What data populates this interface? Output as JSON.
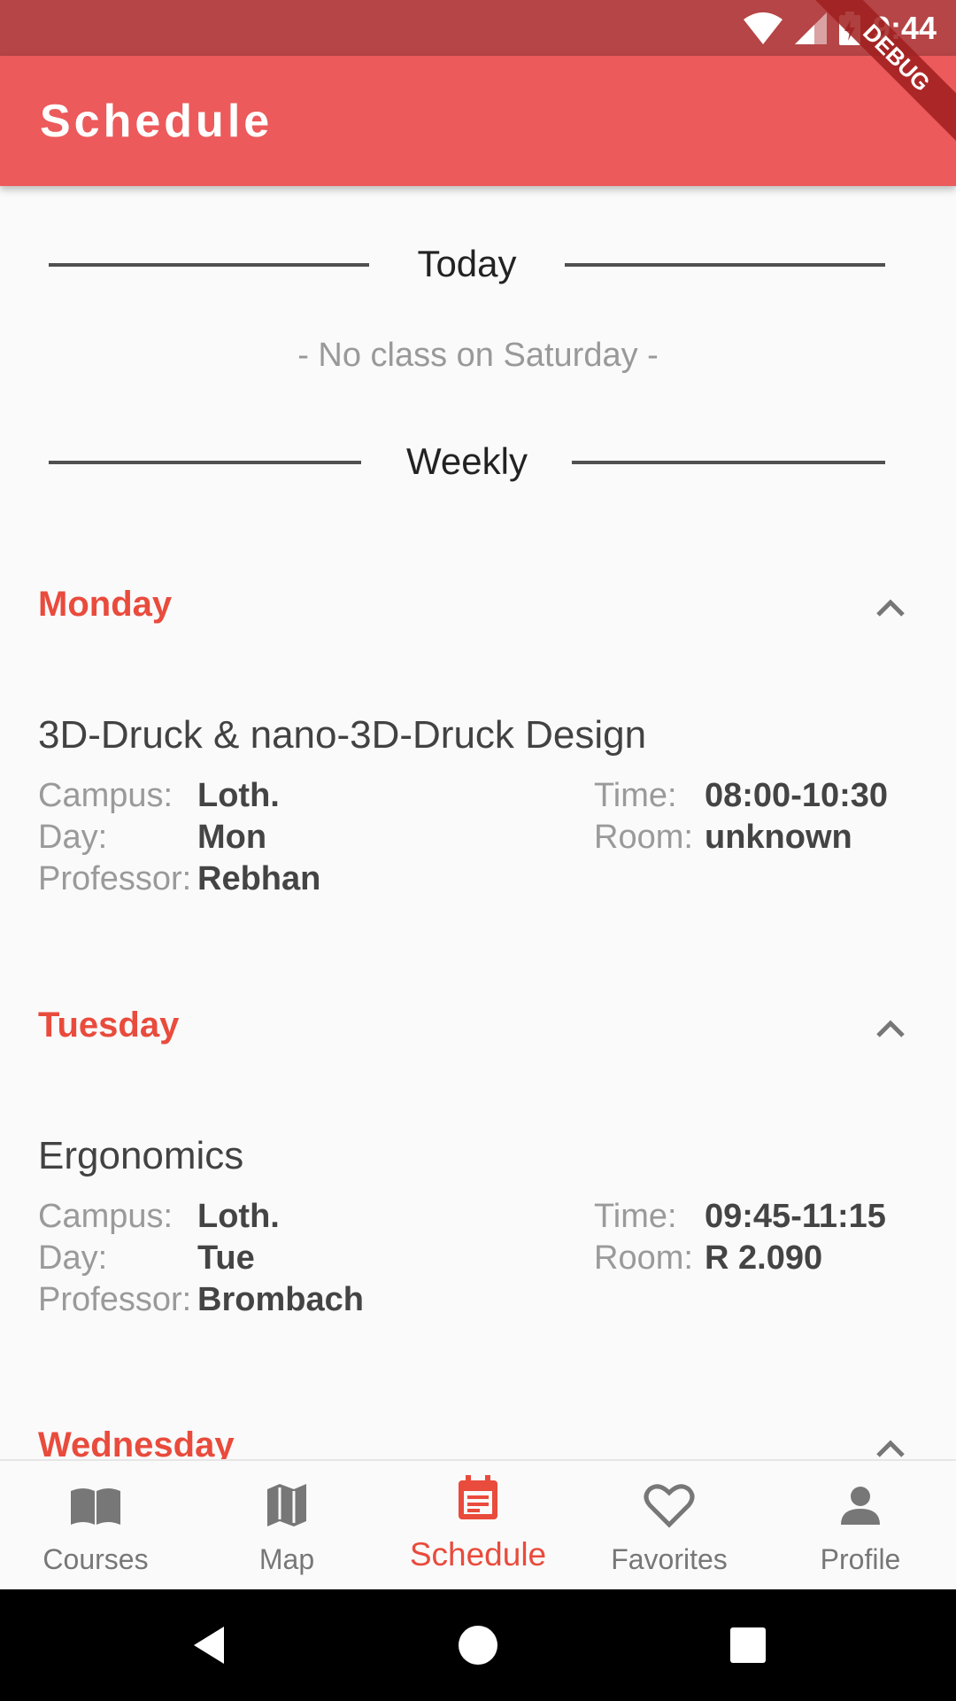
{
  "status_bar": {
    "time": "9:44"
  },
  "debug_banner": "DEBUG",
  "app_bar": {
    "title": "Schedule"
  },
  "today": {
    "label": "Today",
    "message": "- No class on Saturday -"
  },
  "weekly": {
    "label": "Weekly"
  },
  "field_labels": {
    "campus": "Campus:",
    "day": "Day:",
    "professor": "Professor:",
    "time": "Time:",
    "room": "Room:"
  },
  "days": [
    {
      "name": "Monday",
      "course": {
        "title": "3D-Druck & nano-3D-Druck Design",
        "campus": "Loth.",
        "day": "Mon",
        "professor": "Rebhan",
        "time": "08:00-10:30",
        "room": "unknown"
      }
    },
    {
      "name": "Tuesday",
      "course": {
        "title": "Ergonomics",
        "campus": "Loth.",
        "day": "Tue",
        "professor": "Brombach",
        "time": "09:45-11:15",
        "room": "R 2.090"
      }
    },
    {
      "name": "Wednesday"
    }
  ],
  "bottom_nav": [
    {
      "label": "Courses",
      "icon": "book-icon"
    },
    {
      "label": "Map",
      "icon": "map-icon"
    },
    {
      "label": "Schedule",
      "icon": "calendar-icon",
      "active": true
    },
    {
      "label": "Favorites",
      "icon": "heart-icon"
    },
    {
      "label": "Profile",
      "icon": "person-icon"
    }
  ],
  "colors": {
    "accent": "#e94b3c",
    "app_bar": "#ec5a5b",
    "status_bar": "#b54546"
  }
}
